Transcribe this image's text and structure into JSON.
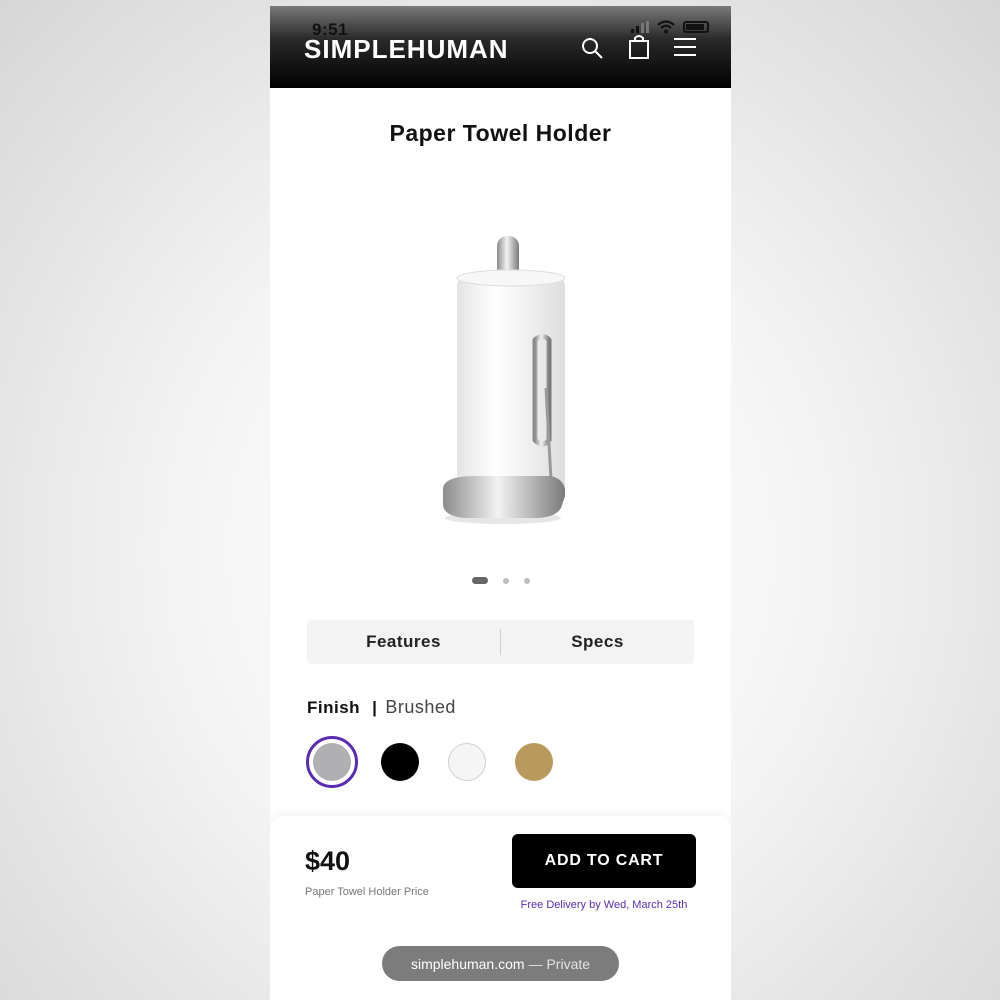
{
  "status_bar": {
    "time": "9:51"
  },
  "header": {
    "logo": "SIMPLEHUMAN",
    "icons": [
      "search-icon",
      "shopping-bag-icon",
      "menu-icon"
    ]
  },
  "product": {
    "title": "Paper Towel Holder",
    "carousel": {
      "total": 3,
      "active": 1
    }
  },
  "tabs": [
    {
      "label": "Features"
    },
    {
      "label": "Specs"
    }
  ],
  "finish": {
    "label": "Finish",
    "separator": "|",
    "value": "Brushed",
    "swatches": [
      {
        "name": "brushed",
        "color": "#b0b0b2",
        "selected": true
      },
      {
        "name": "black",
        "color": "#000000",
        "selected": false
      },
      {
        "name": "white",
        "color": "#f5f5f5",
        "selected": false
      },
      {
        "name": "brass",
        "color": "#b89a5e",
        "selected": false
      }
    ],
    "selected_ring_color": "#5a2bb3"
  },
  "purchase": {
    "price": "$40",
    "price_label": "Paper Towel Holder Price",
    "button_label": "ADD TO CART",
    "delivery": "Free Delivery by Wed, March 25th"
  },
  "browser": {
    "domain": "simplehuman.com",
    "mode": "— Private"
  },
  "colors": {
    "accent": "#5a2bb3",
    "button": "#000000"
  }
}
